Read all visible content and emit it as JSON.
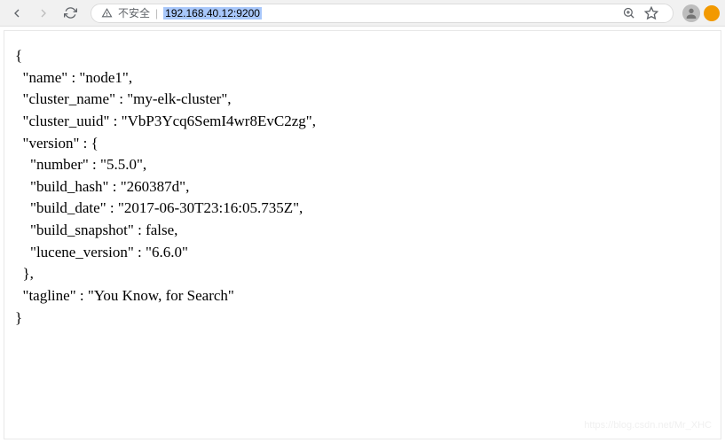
{
  "toolbar": {
    "not_secure_label": "不安全",
    "url": "192.168.40.12:9200"
  },
  "response": {
    "name": "node1",
    "cluster_name": "my-elk-cluster",
    "cluster_uuid": "VbP3Ycq6SemI4wr8EvC2zg",
    "version": {
      "number": "5.5.0",
      "build_hash": "260387d",
      "build_date": "2017-06-30T23:16:05.735Z",
      "build_snapshot": "false",
      "lucene_version": "6.6.0"
    },
    "tagline": "You Know, for Search"
  },
  "watermark": "https://blog.csdn.net/Mr_XHC"
}
